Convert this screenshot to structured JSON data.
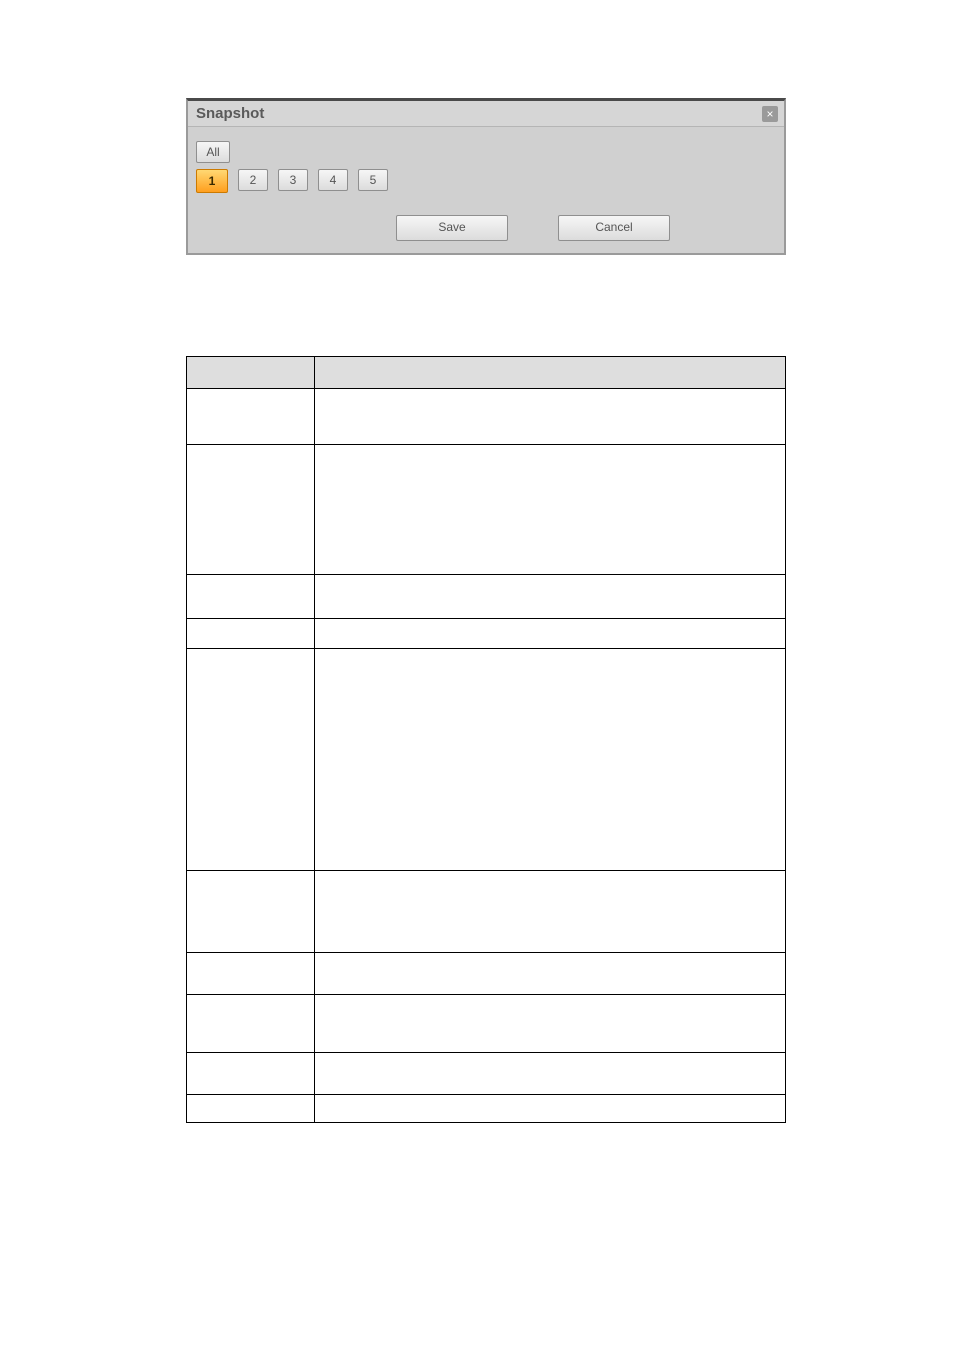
{
  "dialog": {
    "title": "Snapshot",
    "close_glyph": "×",
    "all_label": "All",
    "channels": [
      "1",
      "2",
      "3",
      "4",
      "5"
    ],
    "selected_index": 0,
    "save_label": "Save",
    "cancel_label": "Cancel"
  },
  "table": {
    "header_left": "",
    "header_right": "",
    "rows": [
      {
        "left": "",
        "right": ""
      },
      {
        "left": "",
        "right": ""
      },
      {
        "left": "",
        "right": ""
      },
      {
        "left": "",
        "right": ""
      },
      {
        "left": "",
        "right": ""
      },
      {
        "left": "",
        "right": ""
      },
      {
        "left": "",
        "right": ""
      },
      {
        "left": "",
        "right": ""
      },
      {
        "left": "",
        "right": ""
      },
      {
        "left": "",
        "right": ""
      }
    ]
  }
}
